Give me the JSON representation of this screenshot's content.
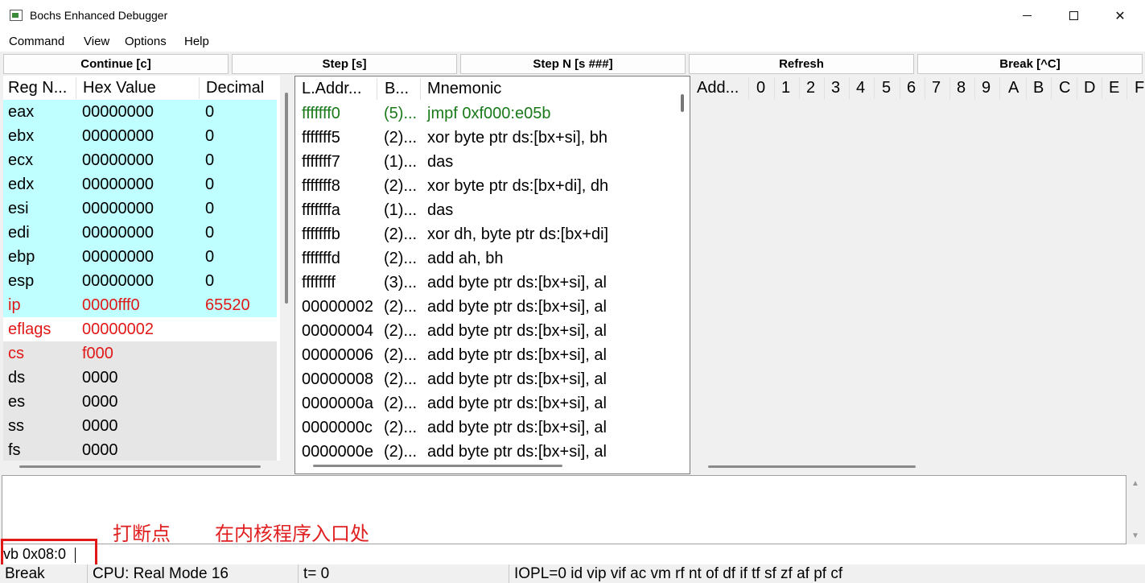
{
  "window": {
    "title": "Bochs Enhanced Debugger"
  },
  "menu": [
    "Command",
    "View",
    "Options",
    "Help"
  ],
  "toolbar": [
    "Continue [c]",
    "Step [s]",
    "Step N [s ###]",
    "Refresh",
    "Break [^C]"
  ],
  "registers": {
    "headers": [
      "Reg N...",
      "Hex Value",
      "Decimal"
    ],
    "rows": [
      {
        "name": "eax",
        "hex": "00000000",
        "dec": "0",
        "bg": "#c0ffff",
        "color": "#000000"
      },
      {
        "name": "ebx",
        "hex": "00000000",
        "dec": "0",
        "bg": "#c0ffff",
        "color": "#000000"
      },
      {
        "name": "ecx",
        "hex": "00000000",
        "dec": "0",
        "bg": "#c0ffff",
        "color": "#000000"
      },
      {
        "name": "edx",
        "hex": "00000000",
        "dec": "0",
        "bg": "#c0ffff",
        "color": "#000000"
      },
      {
        "name": "esi",
        "hex": "00000000",
        "dec": "0",
        "bg": "#c0ffff",
        "color": "#000000"
      },
      {
        "name": "edi",
        "hex": "00000000",
        "dec": "0",
        "bg": "#c0ffff",
        "color": "#000000"
      },
      {
        "name": "ebp",
        "hex": "00000000",
        "dec": "0",
        "bg": "#c0ffff",
        "color": "#000000"
      },
      {
        "name": "esp",
        "hex": "00000000",
        "dec": "0",
        "bg": "#c0ffff",
        "color": "#000000"
      },
      {
        "name": "ip",
        "hex": "0000fff0",
        "dec": "65520",
        "bg": "#c0ffff",
        "color": "#e01818"
      },
      {
        "name": "eflags",
        "hex": "00000002",
        "dec": "",
        "bg": "#ffffff",
        "color": "#e01818"
      },
      {
        "name": "cs",
        "hex": "f000",
        "dec": "",
        "bg": "#e6e6e6",
        "color": "#e01818"
      },
      {
        "name": "ds",
        "hex": "0000",
        "dec": "",
        "bg": "#e6e6e6",
        "color": "#000000"
      },
      {
        "name": "es",
        "hex": "0000",
        "dec": "",
        "bg": "#e6e6e6",
        "color": "#000000"
      },
      {
        "name": "ss",
        "hex": "0000",
        "dec": "",
        "bg": "#e6e6e6",
        "color": "#000000"
      },
      {
        "name": "fs",
        "hex": "0000",
        "dec": "",
        "bg": "#e6e6e6",
        "color": "#000000"
      }
    ]
  },
  "disasm": {
    "headers": [
      "L.Addr...",
      "B...",
      "Mnemonic"
    ],
    "rows": [
      {
        "addr": "fffffff0",
        "bytes": "(5)...",
        "mnem": "jmpf 0xf000:e05b",
        "color": "#1a7a1a"
      },
      {
        "addr": "fffffff5",
        "bytes": "(2)...",
        "mnem": "xor byte ptr ds:[bx+si], bh",
        "color": "#000000"
      },
      {
        "addr": "fffffff7",
        "bytes": "(1)...",
        "mnem": "das",
        "color": "#000000"
      },
      {
        "addr": "fffffff8",
        "bytes": "(2)...",
        "mnem": "xor byte ptr ds:[bx+di], dh",
        "color": "#000000"
      },
      {
        "addr": "fffffffa",
        "bytes": "(1)...",
        "mnem": "das",
        "color": "#000000"
      },
      {
        "addr": "fffffffb",
        "bytes": "(2)...",
        "mnem": "xor dh, byte ptr ds:[bx+di]",
        "color": "#000000"
      },
      {
        "addr": "fffffffd",
        "bytes": "(2)...",
        "mnem": "add ah, bh",
        "color": "#000000"
      },
      {
        "addr": "ffffffff",
        "bytes": "(3)...",
        "mnem": "add byte ptr ds:[bx+si], al",
        "color": "#000000"
      },
      {
        "addr": "00000002",
        "bytes": "(2)...",
        "mnem": "add byte ptr ds:[bx+si], al",
        "color": "#000000"
      },
      {
        "addr": "00000004",
        "bytes": "(2)...",
        "mnem": "add byte ptr ds:[bx+si], al",
        "color": "#000000"
      },
      {
        "addr": "00000006",
        "bytes": "(2)...",
        "mnem": "add byte ptr ds:[bx+si], al",
        "color": "#000000"
      },
      {
        "addr": "00000008",
        "bytes": "(2)...",
        "mnem": "add byte ptr ds:[bx+si], al",
        "color": "#000000"
      },
      {
        "addr": "0000000a",
        "bytes": "(2)...",
        "mnem": "add byte ptr ds:[bx+si], al",
        "color": "#000000"
      },
      {
        "addr": "0000000c",
        "bytes": "(2)...",
        "mnem": "add byte ptr ds:[bx+si], al",
        "color": "#000000"
      },
      {
        "addr": "0000000e",
        "bytes": "(2)...",
        "mnem": "add byte ptr ds:[bx+si], al",
        "color": "#000000"
      }
    ]
  },
  "memory": {
    "headers": [
      "Add...",
      "0",
      "1",
      "2",
      "3",
      "4",
      "5",
      "6",
      "7",
      "8",
      "9",
      "A",
      "B",
      "C",
      "D",
      "E",
      "F"
    ]
  },
  "annotations": [
    "打断点",
    "在内核程序入口处"
  ],
  "command": {
    "value": "vb 0x08:0"
  },
  "status": [
    "Break",
    "CPU: Real Mode 16",
    "t= 0",
    "IOPL=0 id vip vif ac vm rf nt of df if tf sf zf af pf cf"
  ]
}
